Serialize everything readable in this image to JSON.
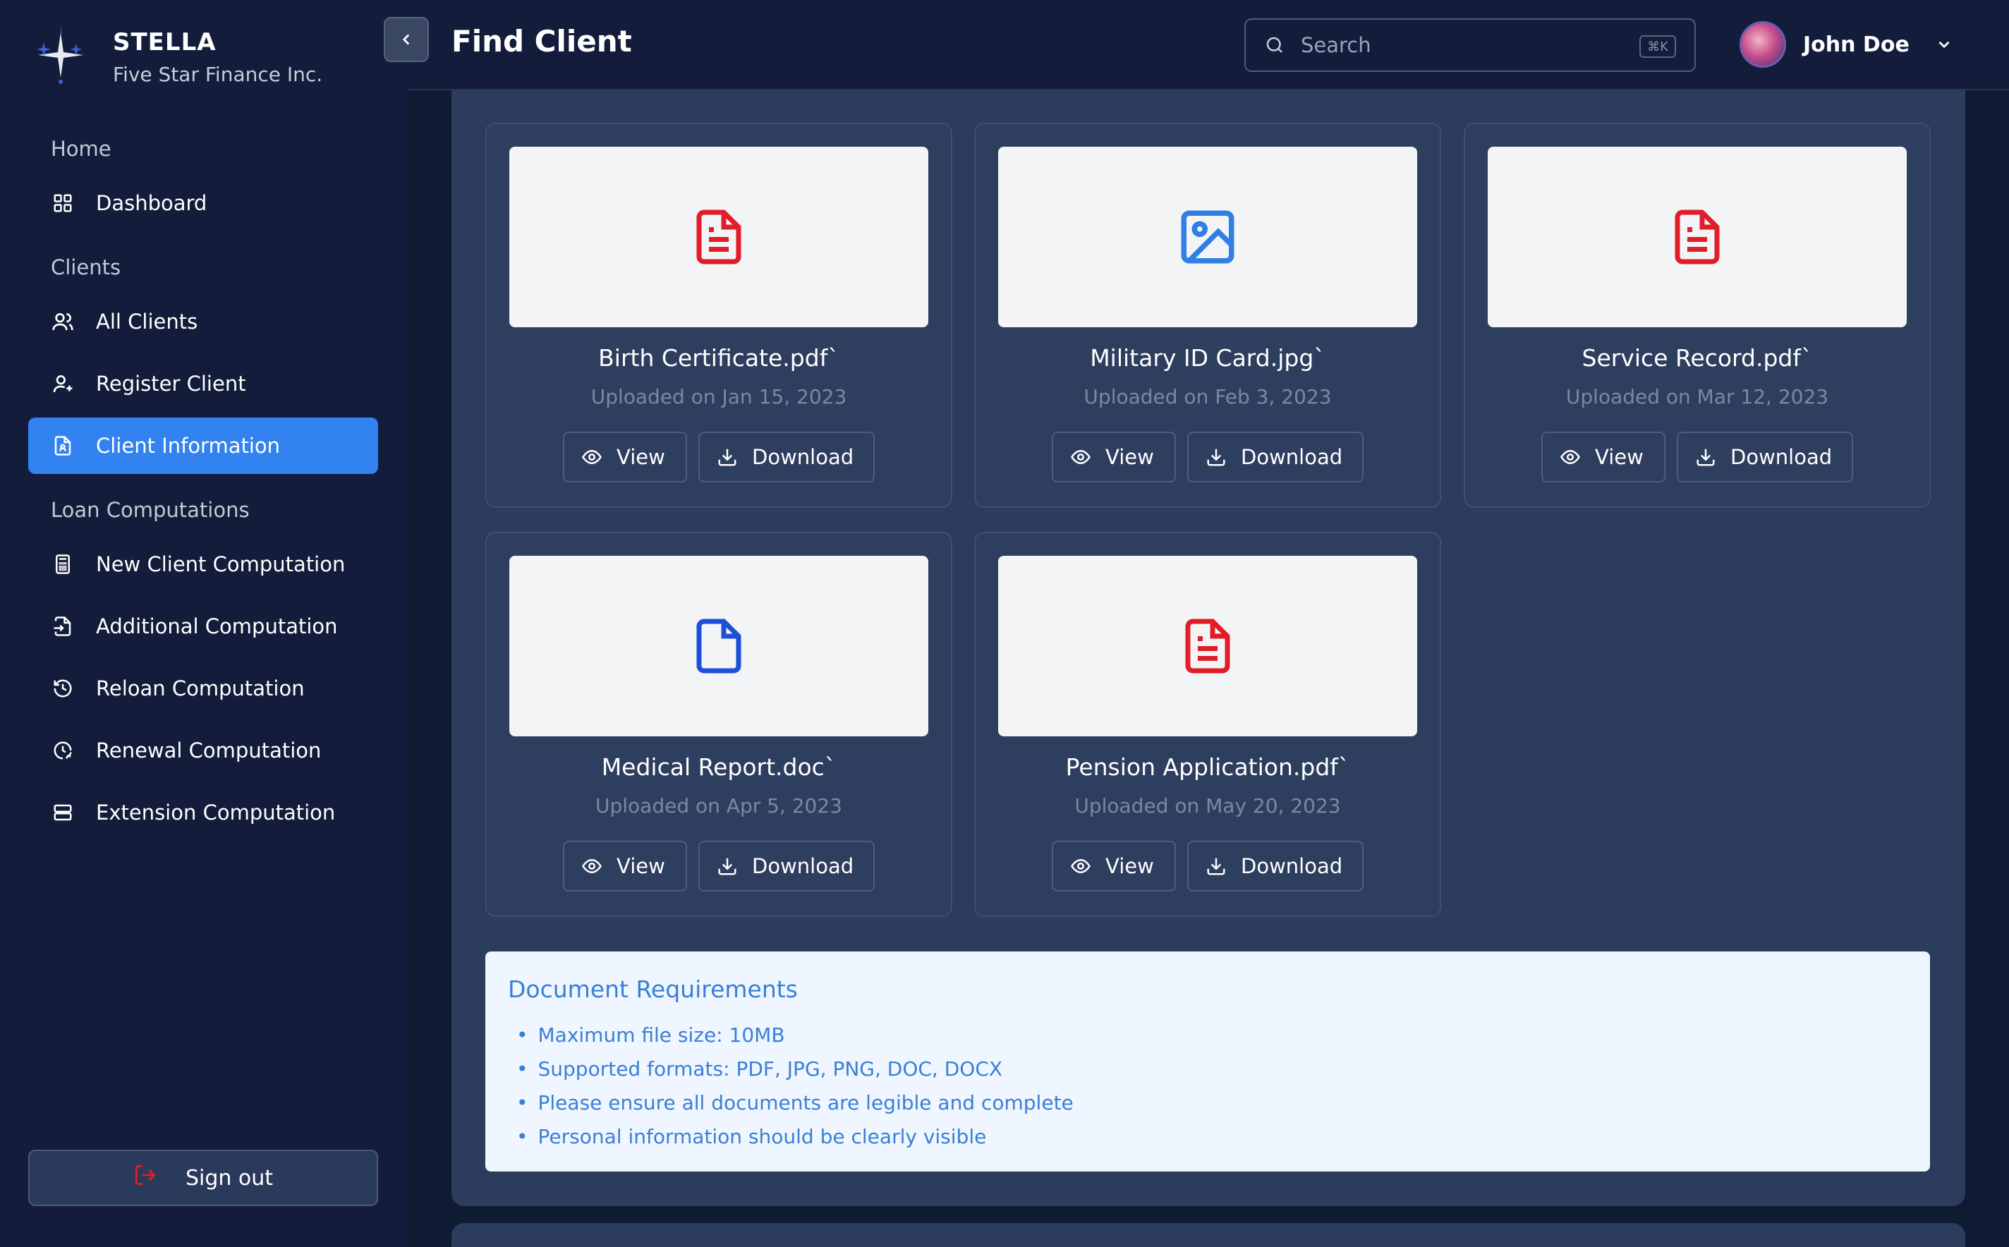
{
  "brand": {
    "name": "STELLA",
    "subtitle": "Five Star Finance Inc."
  },
  "sidebar": {
    "sections": [
      "Home",
      "Clients",
      "Loan Computations"
    ],
    "items": [
      {
        "label": "Dashboard",
        "icon": "grid-icon"
      },
      {
        "label": "All Clients",
        "icon": "users-icon"
      },
      {
        "label": "Register Client",
        "icon": "user-plus-icon"
      },
      {
        "label": "Client Information",
        "icon": "file-user-icon",
        "active": true
      },
      {
        "label": "New Client Computation",
        "icon": "calculator-icon"
      },
      {
        "label": "Additional Computation",
        "icon": "file-input-icon"
      },
      {
        "label": "Reloan Computation",
        "icon": "history-icon"
      },
      {
        "label": "Renewal Computation",
        "icon": "clock-refresh-icon"
      },
      {
        "label": "Extension Computation",
        "icon": "stack-icon"
      }
    ],
    "signout": "Sign out"
  },
  "header": {
    "title": "Find Client",
    "search_placeholder": "Search",
    "search_shortcut": "⌘K",
    "user_name": "John Doe"
  },
  "documents": [
    {
      "name": "Birth Certificate.pdf`",
      "date": "Uploaded on Jan 15, 2023",
      "type": "pdf"
    },
    {
      "name": "Military ID Card.jpg`",
      "date": "Uploaded on Feb 3, 2023",
      "type": "image"
    },
    {
      "name": "Service Record.pdf`",
      "date": "Uploaded on Mar 12, 2023",
      "type": "pdf"
    },
    {
      "name": "Medical Report.doc`",
      "date": "Uploaded on Apr 5, 2023",
      "type": "doc"
    },
    {
      "name": "Pension Application.pdf`",
      "date": "Uploaded on May 20, 2023",
      "type": "pdf"
    }
  ],
  "actions": {
    "view": "View",
    "download": "Download"
  },
  "requirements": {
    "title": "Document Requirements",
    "items": [
      "Maximum file size: 10MB",
      "Supported formats: PDF, JPG, PNG, DOC, DOCX",
      "Please ensure all documents are legible and complete",
      "Personal information should be clearly visible"
    ]
  },
  "colors": {
    "accent": "#3283f0",
    "pdf": "#e11d2a",
    "image": "#2f7fe6",
    "doc": "#1d4fd8"
  }
}
